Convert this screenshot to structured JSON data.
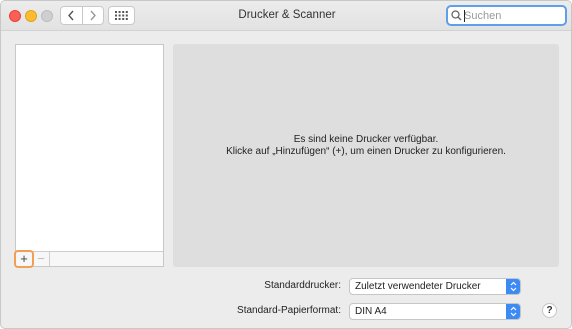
{
  "window": {
    "title": "Drucker & Scanner"
  },
  "search": {
    "placeholder": "Suchen",
    "value": ""
  },
  "printer_list": {
    "add_label": "+",
    "remove_label": "−"
  },
  "detail": {
    "empty_line1": "Es sind keine Drucker verfügbar.",
    "empty_line2": "Klicke auf „Hinzufügen“ (+), um einen Drucker zu konfigurieren."
  },
  "settings": {
    "default_printer_label": "Standarddrucker:",
    "default_printer_value": "Zuletzt verwendeter Drucker",
    "paper_format_label": "Standard-Papierformat:",
    "paper_format_value": "DIN A4"
  },
  "help": {
    "label": "?"
  },
  "colors": {
    "accent": "#3c8bf5",
    "focus_ring": "#5f9ee8",
    "add_highlight": "#f0a056"
  }
}
